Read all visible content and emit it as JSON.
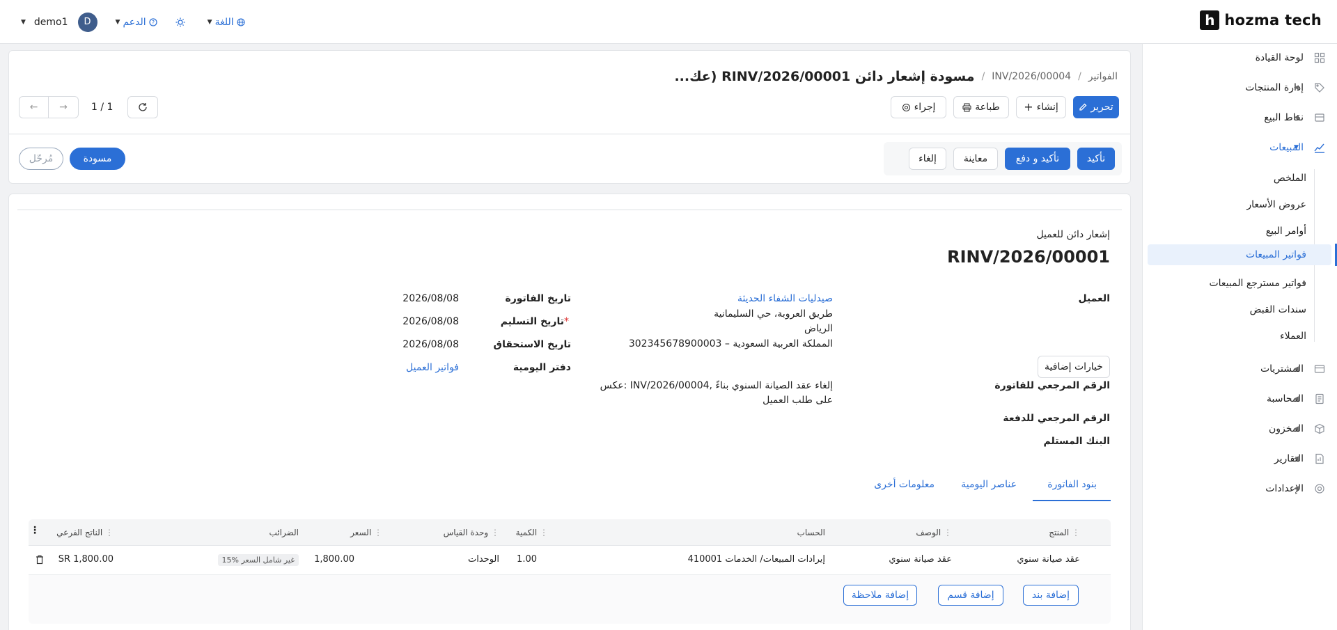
{
  "brand": {
    "mark": "h",
    "name": "hozma tech"
  },
  "topnav": {
    "user": "demo1",
    "avatar_initial": "D",
    "support": "الدعم",
    "language": "اللغة"
  },
  "sidebar": {
    "items": [
      {
        "label": "لوحة القيادة",
        "icon": "grid-icon"
      },
      {
        "label": "إدارة المنتجات",
        "icon": "tag-icon"
      },
      {
        "label": "نقاط البيع",
        "icon": "store-icon"
      },
      {
        "label": "المبيعات",
        "icon": "chart-line-icon"
      },
      {
        "label": "المشتريات",
        "icon": "card-icon"
      },
      {
        "label": "المحاسبة",
        "icon": "ledger-icon"
      },
      {
        "label": "المخزون",
        "icon": "box-icon"
      },
      {
        "label": "التقارير",
        "icon": "report-icon"
      },
      {
        "label": "الإعدادات",
        "icon": "gear-icon"
      }
    ],
    "sales_sub": [
      "الملخص",
      "عروض الأسعار",
      "أوامر البيع",
      "فواتير المبيعات",
      "فواتير مسترجع المبيعات",
      "سندات القبض",
      "العملاء"
    ]
  },
  "header": {
    "crumb_root": "الفواتير",
    "crumb_parent": "INV/2026/00004",
    "title": "مسودة إشعار دائن RINV/2026/00001 (عك...",
    "edit": "تحرير",
    "create": "إنشاء",
    "print": "طباعة",
    "action": "إجراء",
    "pager": "1 / 1"
  },
  "statusbar": {
    "confirm": "تأكيد",
    "confirm_pay": "تأكيد و دفع",
    "preview": "معاينة",
    "cancel": "إلغاء",
    "draft": "مسودة",
    "posted": "مُرحّل"
  },
  "doc": {
    "type_label": "إشعار دائن للعميل",
    "number": "RINV/2026/00001",
    "customer_label": "العميل",
    "customer_name": "صيدليات الشفاء الحديثة",
    "address_line1": "طريق العروبة، حي السليمانية",
    "address_city": "الرياض",
    "address_country_vat": "المملكة العربية السعودية – 302345678900003",
    "extra_options": "خيارات إضافية",
    "invoice_ref_label": "الرقم المرجعي للفاتورة",
    "invoice_ref_value_1": "عكس: INV/2026/00004, إلغاء عقد الصيانة السنوي بناءً",
    "invoice_ref_value_2": "على طلب العميل",
    "payment_ref_label": "الرقم المرجعي للدفعة",
    "bank_label": "البنك المستلم",
    "invoice_date_label": "تاريخ الفاتورة",
    "invoice_date": "2026/08/08",
    "delivery_date_label": "تاريخ التسليم",
    "delivery_date": "2026/08/08",
    "due_date_label": "تاريخ الاستحقاق",
    "due_date": "2026/08/08",
    "journal_label": "دفتر اليومية",
    "journal": "فواتير العميل"
  },
  "tabs": [
    "بنود الفاتورة",
    "عناصر اليومية",
    "معلومات أخرى"
  ],
  "table": {
    "headers": [
      "المنتج",
      "الوصف",
      "الحساب",
      "الكمية",
      "وحدة القياس",
      "السعر",
      "الضرائب",
      "الناتج الفرعي"
    ],
    "row": {
      "product": "عقد صيانة سنوي",
      "description": "عقد صيانة سنوي",
      "account": "410001 إيرادات المبيعات/ الخدمات",
      "qty": "1.00",
      "uom": "الوحدات",
      "price": "1,800.00",
      "tax": "15% غير شامل السعر",
      "subtotal": "SR 1,800.00"
    },
    "add_line": "إضافة بند",
    "add_section": "إضافة قسم",
    "add_note": "إضافة ملاحظة"
  },
  "colors": {
    "accent": "#2b6fd6"
  }
}
